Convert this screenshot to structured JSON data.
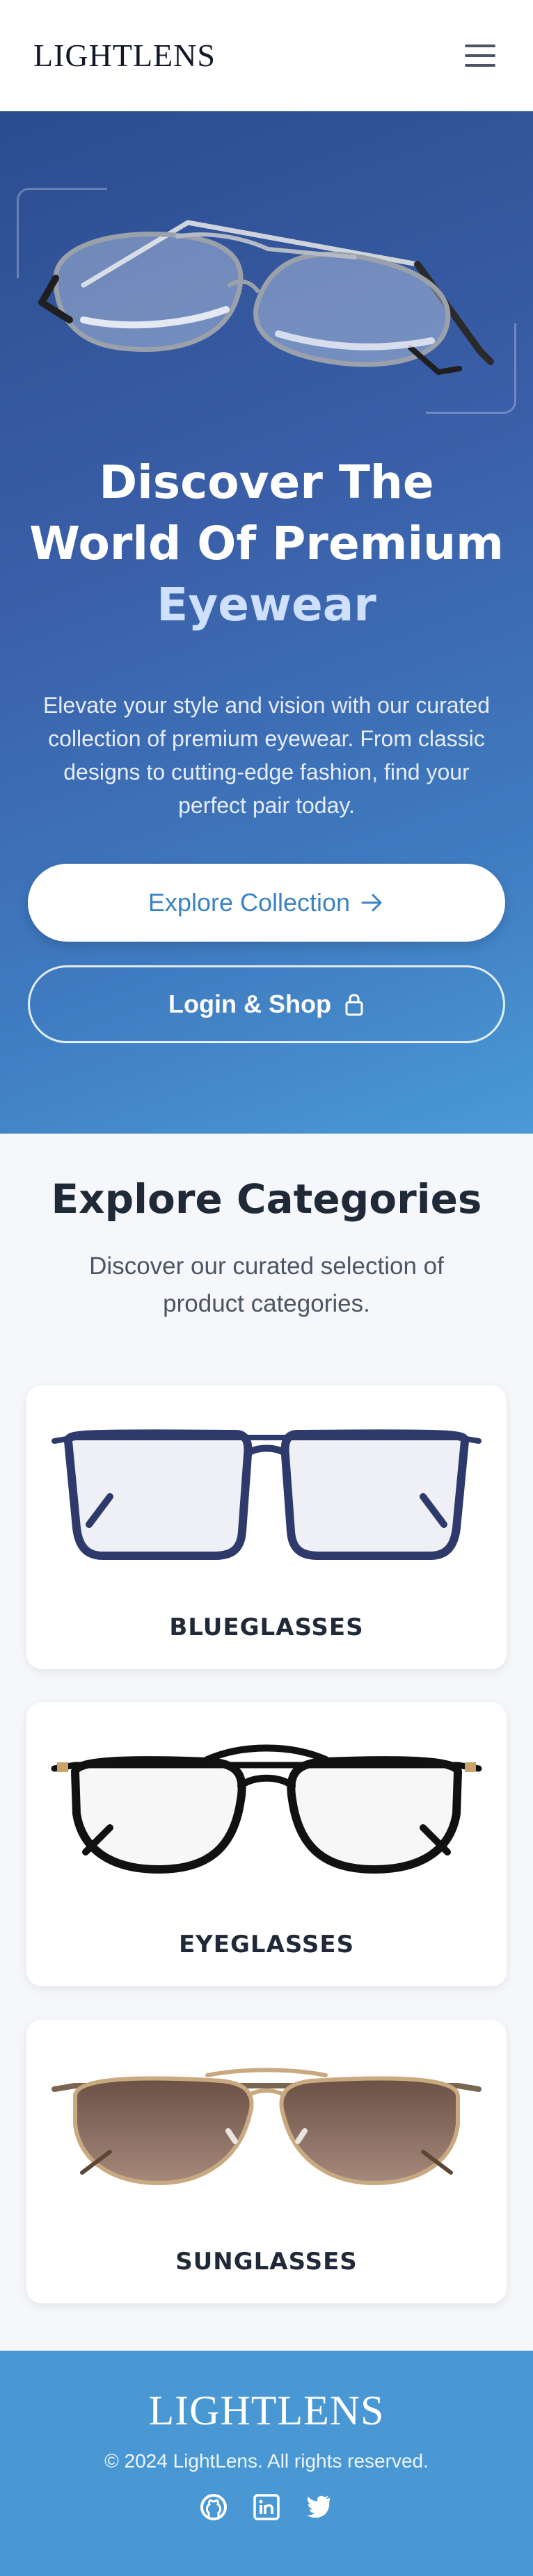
{
  "header": {
    "logo": "LIGHTLENS",
    "menu_icon": "hamburger-menu-icon"
  },
  "hero": {
    "title_line1": "Discover The",
    "title_line2": "World Of Premium",
    "title_accent": "Eyewear",
    "description": "Elevate your style and vision with our curated collection of premium eyewear. From classic designs to cutting-edge fashion, find your perfect pair today.",
    "explore_button": "Explore Collection",
    "explore_icon": "arrow-right-icon",
    "login_button": "Login & Shop",
    "login_icon": "lock-icon"
  },
  "categories": {
    "title": "Explore Categories",
    "subtitle": "Discover our curated selection of product categories.",
    "items": [
      {
        "label": "BLUEGLASSES",
        "frame_color": "#2e3a6b"
      },
      {
        "label": "EYEGLASSES",
        "frame_color": "#111111"
      },
      {
        "label": "SUNGLASSES",
        "frame_color": "#b89a72"
      }
    ]
  },
  "footer": {
    "logo": "LIGHTLENS",
    "copyright": "© 2024 LightLens. All rights reserved.",
    "social_icons": [
      "github-icon",
      "linkedin-icon",
      "twitter-icon"
    ]
  },
  "colors": {
    "accent": "#3b82c4",
    "hero_gradient_start": "#2c4c90",
    "hero_gradient_end": "#4a9ad6",
    "footer": "#4a98d3"
  }
}
